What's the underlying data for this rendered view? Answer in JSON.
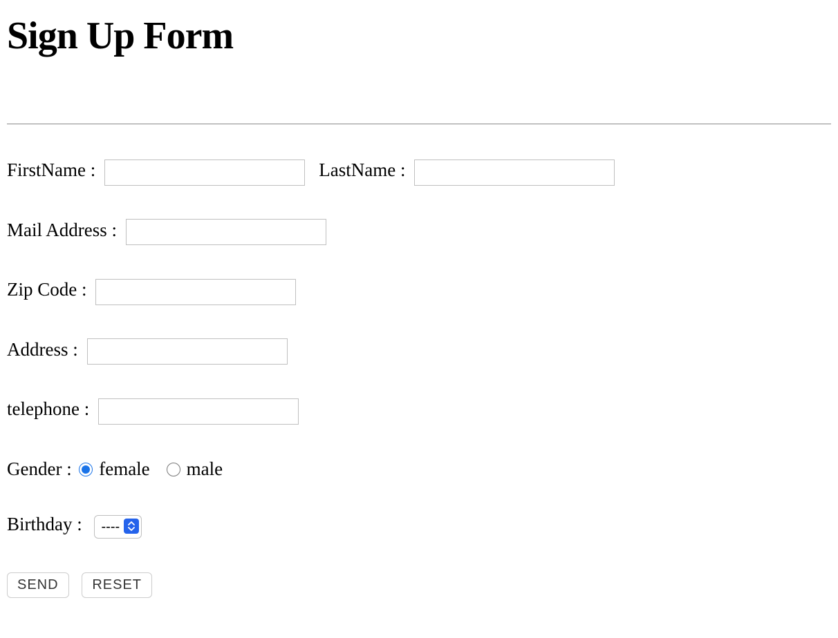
{
  "title": "Sign Up Form",
  "fields": {
    "firstname_label": "FirstName :",
    "lastname_label": "LastName :",
    "mail_label": "Mail Address :",
    "zip_label": "Zip Code :",
    "address_label": "Address :",
    "telephone_label": "telephone :",
    "gender_label": "Gender :",
    "gender_female": "female",
    "gender_male": "male",
    "birthday_label": "Birthday :",
    "birthday_selected": "----"
  },
  "buttons": {
    "send": "SEND",
    "reset": "RESET"
  }
}
